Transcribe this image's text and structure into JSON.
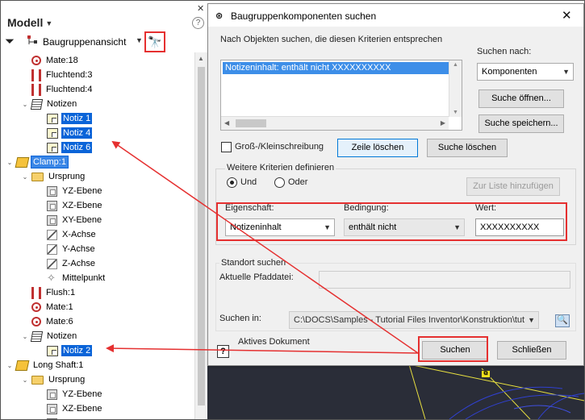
{
  "browser": {
    "title": "Modell",
    "view_label": "Baugruppenansicht",
    "tree": [
      {
        "label": "Mate:18",
        "icon": "mate-icon",
        "indent": 1,
        "expander": ""
      },
      {
        "label": "Fluchtend:3",
        "icon": "flush-icon",
        "indent": 1,
        "expander": ""
      },
      {
        "label": "Fluchtend:4",
        "icon": "flush-icon",
        "indent": 1,
        "expander": ""
      },
      {
        "label": "Notizen",
        "icon": "notes-icon",
        "indent": 1,
        "expander": "expanded"
      },
      {
        "label": "Notiz 1",
        "icon": "note-icon",
        "indent": 2,
        "expander": "",
        "selected": true
      },
      {
        "label": "Notiz 4",
        "icon": "note-icon",
        "indent": 2,
        "expander": "",
        "selected": true
      },
      {
        "label": "Notiz 6",
        "icon": "note-icon",
        "indent": 2,
        "expander": "",
        "selected": true
      },
      {
        "label": "Clamp:1",
        "icon": "component-icon",
        "indent": 0,
        "expander": "expanded",
        "selected": true
      },
      {
        "label": "Ursprung",
        "icon": "folder-icon",
        "indent": 1,
        "expander": "expanded"
      },
      {
        "label": "YZ-Ebene",
        "icon": "plane-icon",
        "indent": 2,
        "expander": ""
      },
      {
        "label": "XZ-Ebene",
        "icon": "plane-icon",
        "indent": 2,
        "expander": ""
      },
      {
        "label": "XY-Ebene",
        "icon": "plane-icon",
        "indent": 2,
        "expander": ""
      },
      {
        "label": "X-Achse",
        "icon": "axis-icon",
        "indent": 2,
        "expander": ""
      },
      {
        "label": "Y-Achse",
        "icon": "axis-icon",
        "indent": 2,
        "expander": ""
      },
      {
        "label": "Z-Achse",
        "icon": "axis-icon",
        "indent": 2,
        "expander": ""
      },
      {
        "label": "Mittelpunkt",
        "icon": "point-icon",
        "indent": 2,
        "expander": ""
      },
      {
        "label": "Flush:1",
        "icon": "flush-icon",
        "indent": 1,
        "expander": ""
      },
      {
        "label": "Mate:1",
        "icon": "mate-icon",
        "indent": 1,
        "expander": ""
      },
      {
        "label": "Mate:6",
        "icon": "mate-icon",
        "indent": 1,
        "expander": ""
      },
      {
        "label": "Notizen",
        "icon": "notes-icon",
        "indent": 1,
        "expander": "expanded"
      },
      {
        "label": "Notiz 2",
        "icon": "note-icon",
        "indent": 2,
        "expander": "",
        "selected": true
      },
      {
        "label": "Long Shaft:1",
        "icon": "component-icon",
        "indent": 0,
        "expander": "expanded"
      },
      {
        "label": "Ursprung",
        "icon": "folder-icon",
        "indent": 1,
        "expander": "expanded"
      },
      {
        "label": "YZ-Ebene",
        "icon": "plane-icon",
        "indent": 2,
        "expander": ""
      },
      {
        "label": "XZ-Ebene",
        "icon": "plane-icon",
        "indent": 2,
        "expander": ""
      },
      {
        "label": "",
        "icon": "plane-icon",
        "indent": 2,
        "expander": ""
      }
    ]
  },
  "dialog": {
    "title": "Baugruppenkomponenten suchen",
    "criteria_group_label": "Nach Objekten suchen, die diesen Kriterien entsprechen",
    "criteria_item": "Notizeninhalt:   enthält nicht  XXXXXXXXXX",
    "search_for_label": "Suchen nach:",
    "search_for_value": "Komponenten",
    "open_search_button": "Suche öffnen...",
    "save_search_button": "Suche speichern...",
    "case_sensitive_label": "Groß-/Kleinschreibung",
    "delete_row_button": "Zeile löschen",
    "delete_search_button": "Suche löschen",
    "more_criteria_label": "Weitere Kriterien definieren",
    "and_label": "Und",
    "or_label": "Oder",
    "add_to_list_button": "Zur Liste hinzufügen",
    "property_label": "Eigenschaft:",
    "property_value": "Notizeninhalt",
    "condition_label": "Bedingung:",
    "condition_value": "enthält nicht",
    "value_label": "Wert:",
    "value_value": "XXXXXXXXXX",
    "location_label": "Standort suchen",
    "current_path_label": "Aktuelle Pfaddatei:",
    "current_path_value": "",
    "search_in_label": "Suchen in:",
    "search_in_value": "C:\\DOCS\\Samples - Tutorial Files Inventor\\Konstruktion\\tut",
    "active_doc_label": "Aktives Dokument",
    "search_button": "Suchen",
    "close_button": "Schließen"
  },
  "colors": {
    "highlight": "#e53030",
    "selection": "#0a64d8",
    "list_selection": "#3d8ee8"
  }
}
